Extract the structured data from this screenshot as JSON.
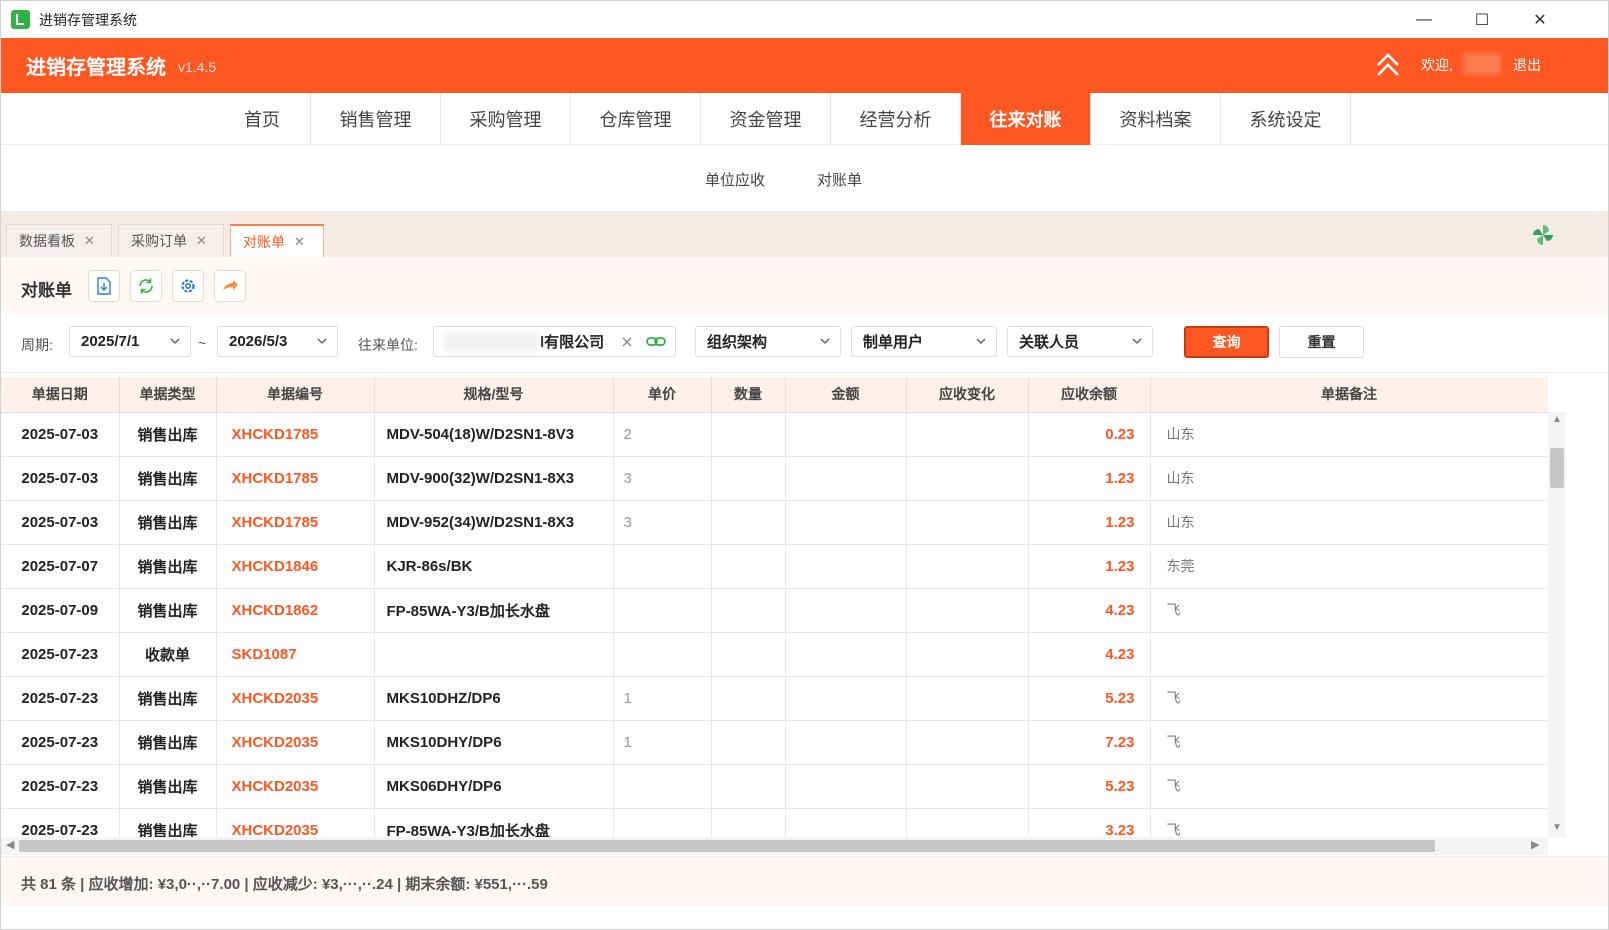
{
  "window": {
    "title": "进销存管理系统",
    "minimize": "—",
    "maximize": "☐",
    "close": "✕"
  },
  "header": {
    "brand": "进销存管理系统",
    "version": "v1.4.5",
    "welcome": "欢迎,",
    "logout": "退出"
  },
  "mainnav": [
    {
      "label": "首页"
    },
    {
      "label": "销售管理"
    },
    {
      "label": "采购管理"
    },
    {
      "label": "仓库管理"
    },
    {
      "label": "资金管理"
    },
    {
      "label": "经营分析"
    },
    {
      "label": "往来对账"
    },
    {
      "label": "资料档案"
    },
    {
      "label": "系统设定"
    }
  ],
  "mainnav_active": "往来对账",
  "subnav": [
    {
      "label": "单位应收"
    },
    {
      "label": "对账单"
    }
  ],
  "pagetabs": [
    {
      "label": "数据看板"
    },
    {
      "label": "采购订单"
    },
    {
      "label": "对账单"
    }
  ],
  "toolbar": {
    "title": "对账单"
  },
  "filters": {
    "period_label": "周期:",
    "start_date": "2025/7/1",
    "tilde": "~",
    "end_date": "2026/5/3",
    "partner_label": "往来单位:",
    "partner_value": "l有限公司",
    "org": "组织架构",
    "creator": "制单用户",
    "related": "关联人员",
    "query": "查询",
    "reset": "重置"
  },
  "table": {
    "headers": [
      "单据日期",
      "单据类型",
      "单据编号",
      "规格/型号",
      "单价",
      "数量",
      "金额",
      "应收变化",
      "应收余额",
      "单据备注"
    ],
    "rows": [
      {
        "date": "2025-07-03",
        "type": "销售出库",
        "code": "XHCKD1785",
        "spec": "MDV-504(18)W/D2SN1-8V3",
        "price": "2",
        "balance": "0.23",
        "note": "山东"
      },
      {
        "date": "2025-07-03",
        "type": "销售出库",
        "code": "XHCKD1785",
        "spec": "MDV-900(32)W/D2SN1-8X3",
        "price": "3",
        "balance": "1.23",
        "note": "山东"
      },
      {
        "date": "2025-07-03",
        "type": "销售出库",
        "code": "XHCKD1785",
        "spec": "MDV-952(34)W/D2SN1-8X3",
        "price": "3",
        "balance": "1.23",
        "note": "山东"
      },
      {
        "date": "2025-07-07",
        "type": "销售出库",
        "code": "XHCKD1846",
        "spec": "KJR-86s/BK",
        "price": "",
        "balance": "1.23",
        "note": "东莞"
      },
      {
        "date": "2025-07-09",
        "type": "销售出库",
        "code": "XHCKD1862",
        "spec": "FP-85WA-Y3/B加长水盘",
        "price": "",
        "balance": "4.23",
        "note": "飞"
      },
      {
        "date": "2025-07-23",
        "type": "收款单",
        "code": "SKD1087",
        "spec": "",
        "price": "",
        "balance": "4.23",
        "note": ""
      },
      {
        "date": "2025-07-23",
        "type": "销售出库",
        "code": "XHCKD2035",
        "spec": "MKS10DHZ/DP6",
        "price": "1",
        "balance": "5.23",
        "note": "飞"
      },
      {
        "date": "2025-07-23",
        "type": "销售出库",
        "code": "XHCKD2035",
        "spec": "MKS10DHY/DP6",
        "price": "1",
        "balance": "7.23",
        "note": "飞"
      },
      {
        "date": "2025-07-23",
        "type": "销售出库",
        "code": "XHCKD2035",
        "spec": "MKS06DHY/DP6",
        "price": "",
        "balance": "5.23",
        "note": "飞"
      },
      {
        "date": "2025-07-23",
        "type": "销售出库",
        "code": "XHCKD2035",
        "spec": "FP-85WA-Y3/B加长水盘",
        "price": "",
        "balance": "3.23",
        "note": "飞"
      }
    ]
  },
  "footer": {
    "summary": "共 81 条 | 应收增加: ¥3,0··,··7.00 | 应收减少: ¥3,···,··.24 | 期末余额: ¥551,···.59"
  },
  "colors": {
    "accent": "#ff5722"
  }
}
